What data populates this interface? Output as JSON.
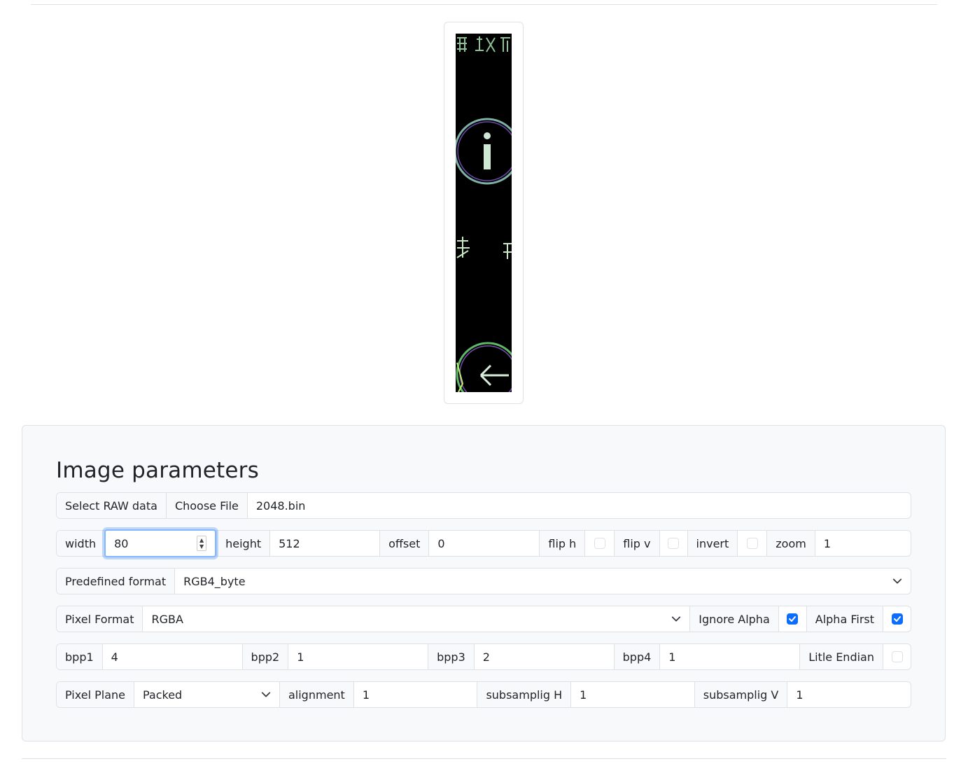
{
  "panel": {
    "title": "Image parameters"
  },
  "file_row": {
    "label": "Select RAW data",
    "button": "Choose File",
    "filename": "2048.bin"
  },
  "dims_row": {
    "width_label": "width",
    "width_value": "80",
    "height_label": "height",
    "height_value": "512",
    "offset_label": "offset",
    "offset_value": "0",
    "fliph_label": "flip h",
    "fliph_checked": false,
    "flipv_label": "flip v",
    "flipv_checked": false,
    "invert_label": "invert",
    "invert_checked": false,
    "zoom_label": "zoom",
    "zoom_value": "1"
  },
  "predef_row": {
    "label": "Predefined format",
    "value": "RGB4_byte"
  },
  "pixel_row": {
    "label": "Pixel Format",
    "value": "RGBA",
    "ignore_alpha_label": "Ignore Alpha",
    "ignore_alpha_checked": true,
    "alpha_first_label": "Alpha First",
    "alpha_first_checked": true
  },
  "bpp_row": {
    "bpp1_label": "bpp1",
    "bpp1_value": "4",
    "bpp2_label": "bpp2",
    "bpp2_value": "1",
    "bpp3_label": "bpp3",
    "bpp3_value": "2",
    "bpp4_label": "bpp4",
    "bpp4_value": "1",
    "endian_label": "Litle Endian",
    "endian_checked": false
  },
  "plane_row": {
    "label": "Pixel Plane",
    "value": "Packed",
    "alignment_label": "alignment",
    "alignment_value": "1",
    "subh_label": "subsamplig H",
    "subh_value": "1",
    "subv_label": "subsamplig V",
    "subv_value": "1"
  },
  "colors": {
    "accent": "#0d6efd",
    "focus_ring": "#86b7fe",
    "panel_bg": "#f8f9fa",
    "border": "#dee2e6"
  },
  "icons": {
    "select_caret": "chevron-down-icon",
    "check": "check-icon",
    "spinner": "spinner-arrows-icon"
  }
}
